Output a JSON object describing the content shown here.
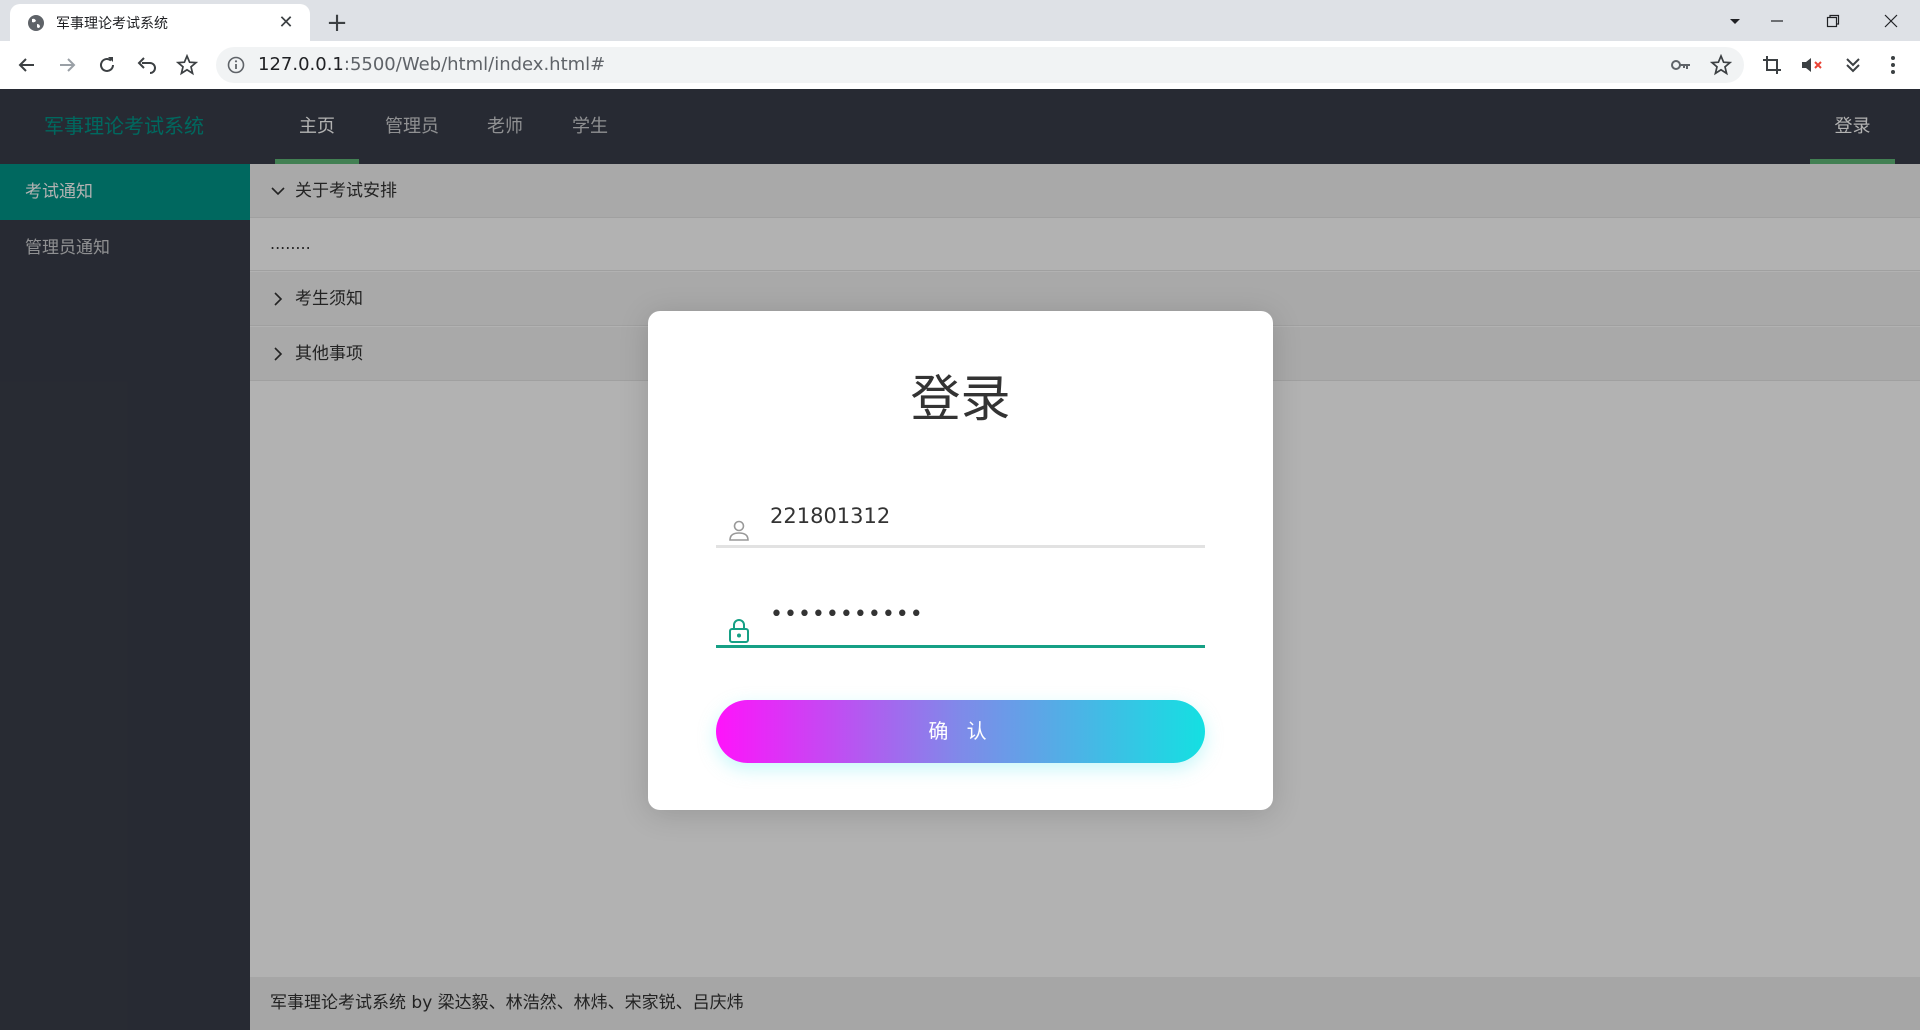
{
  "browser": {
    "tab_title": "军事理论考试系统",
    "new_tab": "+",
    "close_tab": "✕",
    "url_host": "127.0.0.1",
    "url_rest": ":5500/Web/html/index.html#"
  },
  "nav": {
    "brand": "军事理论考试系统",
    "items": [
      {
        "label": "主页",
        "active": true
      },
      {
        "label": "管理员",
        "active": false
      },
      {
        "label": "老师",
        "active": false
      },
      {
        "label": "学生",
        "active": false
      }
    ],
    "login": "登录"
  },
  "sidebar": {
    "items": [
      {
        "label": "考试通知",
        "active": true
      },
      {
        "label": "管理员通知",
        "active": false
      }
    ]
  },
  "collapse": [
    {
      "title": "关于考试安排",
      "expanded": true,
      "body": "........"
    },
    {
      "title": "考生须知",
      "expanded": false
    },
    {
      "title": "其他事项",
      "expanded": false
    }
  ],
  "footer": "军事理论考试系统 by 梁达毅、林浩然、林炜、宋家锐、吕庆炜",
  "modal": {
    "title": "登录",
    "username": "221801312",
    "password": "•••••••••••",
    "confirm": "确 认",
    "accent": "#16a085"
  }
}
